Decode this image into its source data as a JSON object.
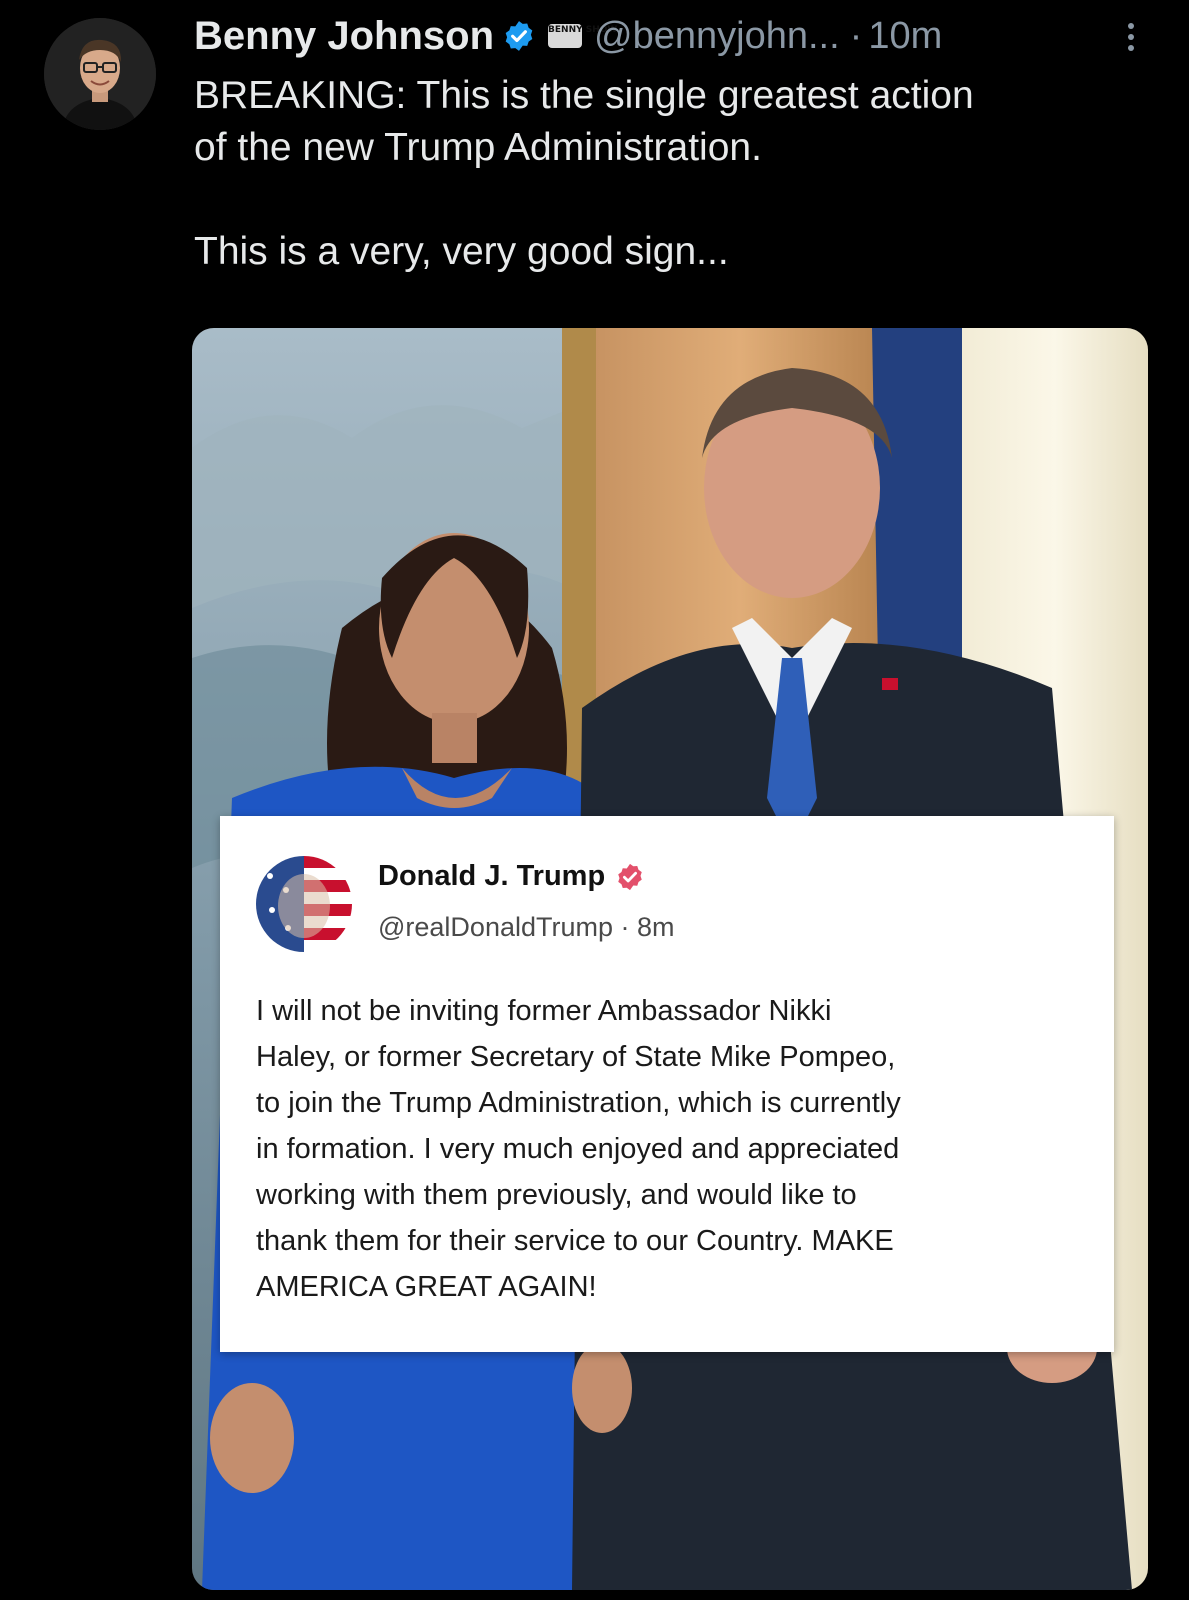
{
  "tweet": {
    "author_name": "Benny Johnson",
    "author_handle": "@bennyjohn...",
    "show_badge": "BENNY SHOW",
    "separator": "·",
    "time": "10m",
    "text": "BREAKING: This is the single greatest action\nof the new Trump Administration.\n\nThis is a very, very good sign..."
  },
  "embedded_post": {
    "name": "Donald J. Trump",
    "handle": "@realDonaldTrump",
    "separator": "·",
    "time": "8m",
    "text": "I will not be inviting former Ambassador Nikki\nHaley, or former Secretary of State Mike Pompeo,\nto join the Trump Administration, which is currently\nin formation. I very much enjoyed and appreciated\nworking with them previously, and would like to\nthank them for their service to our Country. MAKE\nAMERICA GREAT AGAIN!"
  },
  "icons": {
    "verified": "verified-check-icon",
    "more": "more-options-icon"
  },
  "colors": {
    "background": "#000000",
    "text_primary": "#e7e9ea",
    "text_secondary": "#8b98a5",
    "verified_blue": "#1d9bf0",
    "truth_verified_red": "#e3506b"
  }
}
